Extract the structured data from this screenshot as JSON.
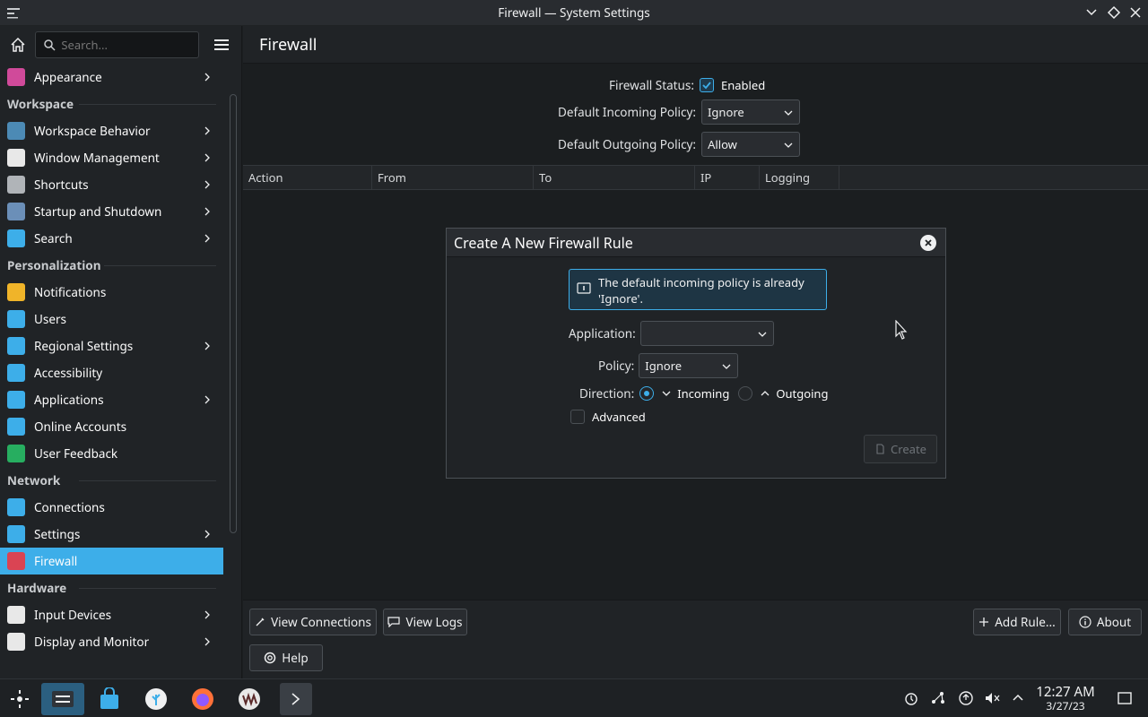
{
  "window": {
    "title": "Firewall — System Settings"
  },
  "sidebar": {
    "search_placeholder": "Search...",
    "items": [
      {
        "type": "item",
        "label": "Appearance",
        "icon": "appearance-icon",
        "chevron": true,
        "color": "#d04a9a"
      },
      {
        "type": "head",
        "label": "Workspace"
      },
      {
        "type": "item",
        "label": "Workspace Behavior",
        "icon": "workspace-icon",
        "chevron": true,
        "color": "#4c8ab5"
      },
      {
        "type": "item",
        "label": "Window Management",
        "icon": "window-icon",
        "chevron": true,
        "color": "#e8e8e8"
      },
      {
        "type": "item",
        "label": "Shortcuts",
        "icon": "keyboard-icon",
        "chevron": true,
        "color": "#b0b4b8"
      },
      {
        "type": "item",
        "label": "Startup and Shutdown",
        "icon": "startup-icon",
        "chevron": true,
        "color": "#6b8fb8"
      },
      {
        "type": "item",
        "label": "Search",
        "icon": "search-icon",
        "chevron": true,
        "color": "#3daee9"
      },
      {
        "type": "head",
        "label": "Personalization"
      },
      {
        "type": "item",
        "label": "Notifications",
        "icon": "bell-icon",
        "chevron": false,
        "color": "#f0b429"
      },
      {
        "type": "item",
        "label": "Users",
        "icon": "users-icon",
        "chevron": false,
        "color": "#3daee9"
      },
      {
        "type": "item",
        "label": "Regional Settings",
        "icon": "regional-icon",
        "chevron": true,
        "color": "#3daee9"
      },
      {
        "type": "item",
        "label": "Accessibility",
        "icon": "accessibility-icon",
        "chevron": false,
        "color": "#3daee9"
      },
      {
        "type": "item",
        "label": "Applications",
        "icon": "applications-icon",
        "chevron": true,
        "color": "#3daee9"
      },
      {
        "type": "item",
        "label": "Online Accounts",
        "icon": "online-accounts-icon",
        "chevron": false,
        "color": "#3daee9"
      },
      {
        "type": "item",
        "label": "User Feedback",
        "icon": "feedback-icon",
        "chevron": false,
        "color": "#27ae60"
      },
      {
        "type": "head",
        "label": "Network"
      },
      {
        "type": "item",
        "label": "Connections",
        "icon": "globe-icon",
        "chevron": false,
        "color": "#3daee9"
      },
      {
        "type": "item",
        "label": "Settings",
        "icon": "globe-icon",
        "chevron": true,
        "color": "#3daee9"
      },
      {
        "type": "item",
        "label": "Firewall",
        "icon": "firewall-icon",
        "chevron": false,
        "color": "#da4453",
        "active": true
      },
      {
        "type": "head",
        "label": "Hardware"
      },
      {
        "type": "item",
        "label": "Input Devices",
        "icon": "mouse-icon",
        "chevron": true,
        "color": "#e8e8e8"
      },
      {
        "type": "item",
        "label": "Display and Monitor",
        "icon": "monitor-icon",
        "chevron": true,
        "color": "#e8e8e8"
      }
    ]
  },
  "main": {
    "title": "Firewall",
    "status_label": "Firewall Status:",
    "status_value": "Enabled",
    "incoming_label": "Default Incoming Policy:",
    "incoming_value": "Ignore",
    "outgoing_label": "Default Outgoing Policy:",
    "outgoing_value": "Allow",
    "columns": [
      "Action",
      "From",
      "To",
      "IP",
      "Logging"
    ]
  },
  "bottom": {
    "view_connections": "View Connections",
    "view_logs": "View Logs",
    "add_rule": "Add Rule...",
    "about": "About",
    "help": "Help"
  },
  "dialog": {
    "title": "Create A New Firewall Rule",
    "info": "The default incoming policy is already 'Ignore'.",
    "application_label": "Application:",
    "application_value": "",
    "policy_label": "Policy:",
    "policy_value": "Ignore",
    "direction_label": "Direction:",
    "incoming": "Incoming",
    "outgoing": "Outgoing",
    "advanced": "Advanced",
    "create": "Create"
  },
  "taskbar": {
    "time": "12:27 AM",
    "date": "3/27/23"
  },
  "colors": {
    "accent": "#3daee9"
  }
}
